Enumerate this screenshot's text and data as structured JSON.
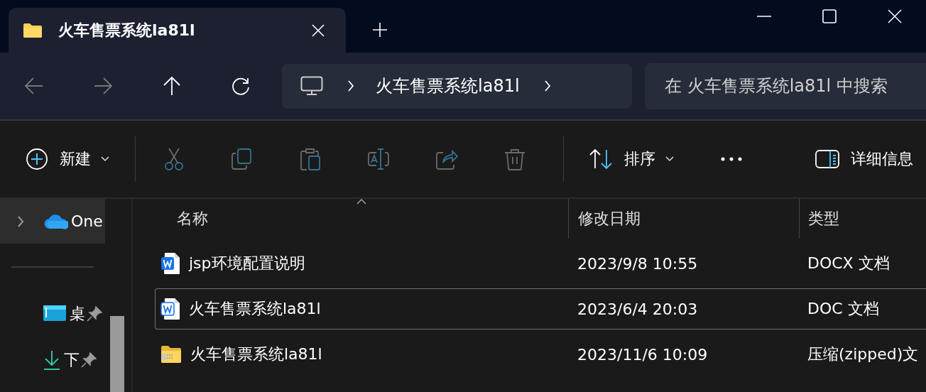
{
  "tabs": [
    {
      "label": "火车售票系统la81l",
      "selected": true
    }
  ],
  "nav_buttons": [
    {
      "kind": "back",
      "disabled": true
    },
    {
      "kind": "forward",
      "disabled": true
    },
    {
      "kind": "up",
      "disabled": false
    },
    {
      "kind": "refresh",
      "disabled": false
    }
  ],
  "address": {
    "segments": [
      "火车售票系统la81l"
    ]
  },
  "search": {
    "placeholder": "在 火车售票系统la81l 中搜索"
  },
  "toolbar": [
    {
      "kind": "new",
      "label": "新建",
      "dropdown": true,
      "disabled": false
    },
    {
      "kind": "separator"
    },
    {
      "kind": "cut",
      "disabled": true
    },
    {
      "kind": "copy",
      "disabled": true
    },
    {
      "kind": "paste",
      "disabled": true
    },
    {
      "kind": "rename",
      "disabled": true
    },
    {
      "kind": "share",
      "disabled": true
    },
    {
      "kind": "delete",
      "disabled": true
    },
    {
      "kind": "separator"
    },
    {
      "kind": "sort",
      "label": "排序",
      "dropdown": true,
      "disabled": false
    },
    {
      "kind": "more",
      "disabled": false
    },
    {
      "kind": "details",
      "label": "详细信息",
      "disabled": false
    }
  ],
  "sidebar": {
    "items": [
      {
        "kind": "onedrive",
        "label": "One",
        "expandable": true,
        "pinned": false,
        "selected": true
      },
      {
        "kind": "divider"
      },
      {
        "kind": "desktop",
        "label": "桌",
        "expandable": false,
        "pinned": true,
        "selected": false
      },
      {
        "kind": "downloads",
        "label": "下",
        "expandable": false,
        "pinned": true,
        "selected": false
      }
    ]
  },
  "table": {
    "columns": [
      {
        "label": "名称",
        "sorted": true
      },
      {
        "label": "修改日期",
        "sorted": false
      },
      {
        "label": "类型",
        "sorted": false
      }
    ],
    "rows": [
      {
        "kind": "docx",
        "name": "jsp环境配置说明",
        "date": "2023/9/8 10:55",
        "type": "DOCX 文档",
        "selected": false
      },
      {
        "kind": "doc",
        "name": "火车售票系统la81l",
        "date": "2023/6/4 20:03",
        "type": "DOC 文档",
        "selected": true
      },
      {
        "kind": "zip",
        "name": "火车售票系统la81l",
        "date": "2023/11/6 10:09",
        "type": "压缩(zipped)文",
        "selected": false
      }
    ]
  }
}
